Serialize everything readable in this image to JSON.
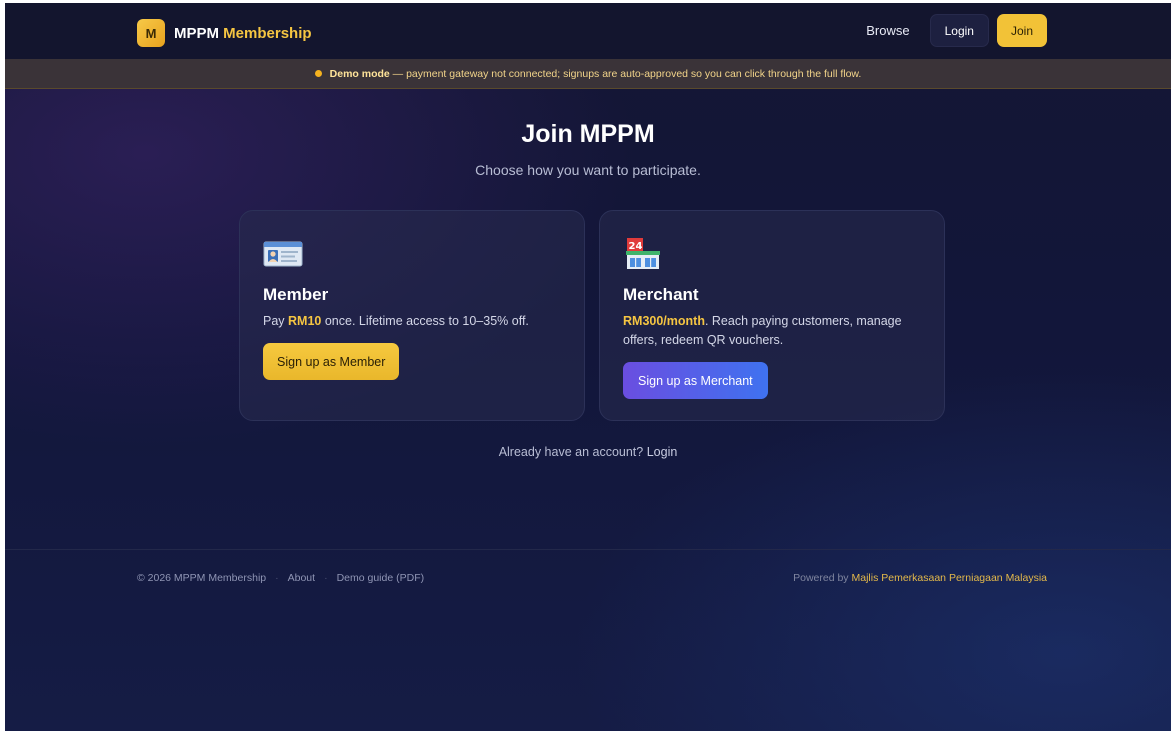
{
  "nav": {
    "logo_letter": "M",
    "brand_primary": "MPPM",
    "brand_accent": "Membership",
    "browse": "Browse",
    "login": "Login",
    "join": "Join"
  },
  "banner": {
    "label": "Demo mode",
    "text": " — payment gateway not connected; signups are auto-approved so you can click through the full flow."
  },
  "page": {
    "title": "Join MPPM",
    "subtitle": "Choose how you want to participate."
  },
  "cards": {
    "member": {
      "icon": "id-card-icon",
      "title": "Member",
      "desc_prefix": "Pay ",
      "price": "RM10",
      "desc_suffix": " once. Lifetime access to 10–35% off.",
      "button": "Sign up as Member"
    },
    "merchant": {
      "icon": "convenience-store-icon",
      "title": "Merchant",
      "price": "RM300/month",
      "desc_suffix": ". Reach paying customers, manage offers, redeem QR vouchers.",
      "button": "Sign up as Merchant"
    }
  },
  "already": {
    "prefix": "Already have an account? ",
    "link": "Login"
  },
  "footer": {
    "copyright": "© 2026 MPPM Membership",
    "about": "About",
    "sep": "·",
    "demo_guide": "Demo guide (PDF)",
    "powered_by": "Powered by ",
    "org": "Majlis Pemerkasaan Perniagaan Malaysia"
  },
  "colors": {
    "accent_gold": "#f5c542",
    "merchant_gradient_start": "#6a4ee0",
    "merchant_gradient_end": "#3f72f0",
    "background": "#141634"
  }
}
